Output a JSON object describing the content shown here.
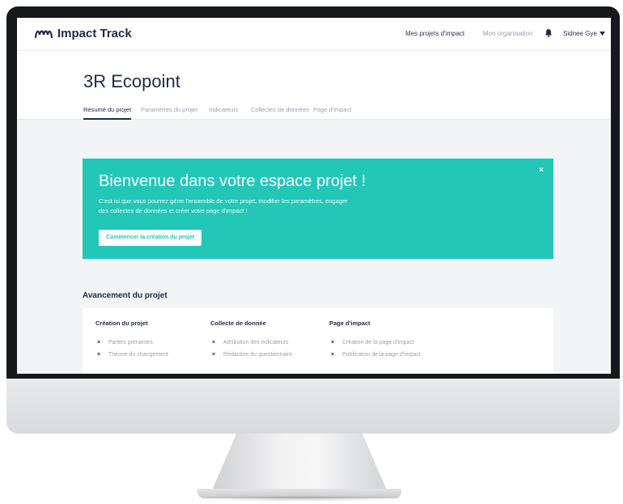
{
  "app": {
    "name": "Impact Track",
    "nav": [
      "Mes projets d'impact",
      "Mon organisation"
    ],
    "user": "Sidnee Gye"
  },
  "project": {
    "title": "3R Ecopoint",
    "tabs": [
      "Résumé du projet",
      "Paramètres du projet",
      "Indicateurs",
      "Collectes de données",
      "Page d'impact"
    ],
    "active_tab": "Résumé du projet"
  },
  "banner": {
    "title": "Bienvenue dans votre espace projet !",
    "text": "C'est ici que vous pourrez gérer l'ensemble de votre projet, modifier les paramètres, engager des collectes de données et créer votre page d'impact !",
    "button": "Commencer la création du projet",
    "close": "×",
    "color": "#22c7b8"
  },
  "progress": {
    "heading": "Avancement du projet",
    "columns": [
      {
        "title": "Création du projet",
        "steps": [
          "Parties prenantes",
          "Théorie du changement"
        ]
      },
      {
        "title": "Collecte de donnée",
        "steps": [
          "Attribution des indicateurs",
          "Rédaction du questionnaire"
        ]
      },
      {
        "title": "Page d'impact",
        "steps": [
          "Création de la page d'impact",
          "Publication de la page d'impact"
        ]
      }
    ],
    "step_icon": "×"
  }
}
